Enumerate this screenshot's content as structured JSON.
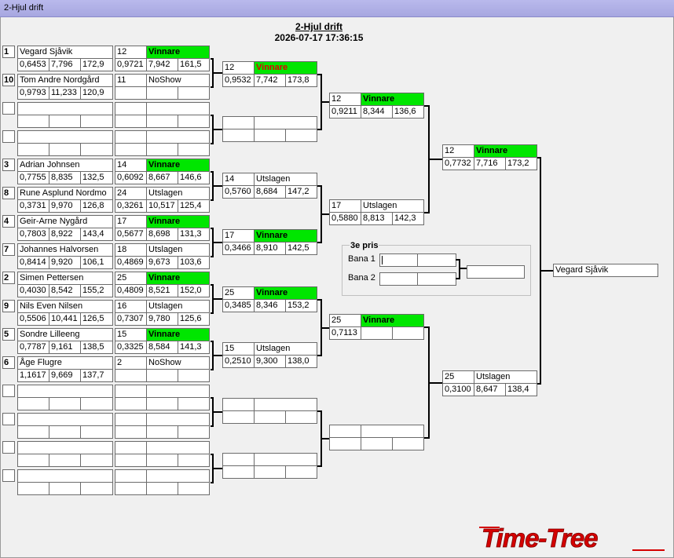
{
  "window": {
    "title": "2-Hjul drift"
  },
  "event": {
    "title": "2-Hjul drift",
    "datetime": "2026-07-17 17:36:15"
  },
  "logo_text": "Time-Tree",
  "colors": {
    "winner_bg": "#00e600",
    "winner_alert_text": "#e00000",
    "titlebar": "#b0b0e6"
  },
  "round1": [
    {
      "seed": "1",
      "name": "Vegard Sjåvik",
      "rt": "0,6453",
      "et": "7,796",
      "speed": "172,9"
    },
    {
      "seed": "10",
      "name": "Tom Andre Nordgård",
      "rt": "0,9793",
      "et": "11,233",
      "speed": "120,9"
    },
    {
      "seed": "",
      "name": "",
      "rt": "",
      "et": "",
      "speed": ""
    },
    {
      "seed": "",
      "name": "",
      "rt": "",
      "et": "",
      "speed": ""
    },
    {
      "seed": "3",
      "name": "Adrian Johnsen",
      "rt": "0,7755",
      "et": "8,835",
      "speed": "132,5"
    },
    {
      "seed": "8",
      "name": "Rune Asplund Nordmo",
      "rt": "0,3731",
      "et": "9,970",
      "speed": "126,8"
    },
    {
      "seed": "4",
      "name": "Geir-Arne Nygård",
      "rt": "0,7803",
      "et": "8,922",
      "speed": "143,4"
    },
    {
      "seed": "7",
      "name": "Johannes Halvorsen",
      "rt": "0,8414",
      "et": "9,920",
      "speed": "106,1"
    },
    {
      "seed": "2",
      "name": "Simen Pettersen",
      "rt": "0,4030",
      "et": "8,542",
      "speed": "155,2"
    },
    {
      "seed": "9",
      "name": "Nils Even Nilsen",
      "rt": "0,5506",
      "et": "10,441",
      "speed": "126,5"
    },
    {
      "seed": "5",
      "name": "Sondre Lilleeng",
      "rt": "0,7787",
      "et": "9,161",
      "speed": "138,5"
    },
    {
      "seed": "6",
      "name": "Åge Flugre",
      "rt": "1,1617",
      "et": "9,669",
      "speed": "137,7"
    },
    {
      "seed": "",
      "name": "",
      "rt": "",
      "et": "",
      "speed": ""
    },
    {
      "seed": "",
      "name": "",
      "rt": "",
      "et": "",
      "speed": ""
    },
    {
      "seed": "",
      "name": "",
      "rt": "",
      "et": "",
      "speed": ""
    },
    {
      "seed": "",
      "name": "",
      "rt": "",
      "et": "",
      "speed": ""
    }
  ],
  "round2": [
    {
      "lane": "12",
      "result": "Vinnare",
      "rt": "0,9721",
      "et": "7,942",
      "speed": "161,5"
    },
    {
      "lane": "11",
      "result": "NoShow",
      "rt": "",
      "et": "",
      "speed": ""
    },
    {
      "lane": "",
      "result": "",
      "rt": "",
      "et": "",
      "speed": ""
    },
    {
      "lane": "",
      "result": "",
      "rt": "",
      "et": "",
      "speed": ""
    },
    {
      "lane": "14",
      "result": "Vinnare",
      "rt": "0,6092",
      "et": "8,667",
      "speed": "146,6"
    },
    {
      "lane": "24",
      "result": "Utslagen",
      "rt": "0,3261",
      "et": "10,517",
      "speed": "125,4"
    },
    {
      "lane": "17",
      "result": "Vinnare",
      "rt": "0,5677",
      "et": "8,698",
      "speed": "131,3"
    },
    {
      "lane": "18",
      "result": "Utslagen",
      "rt": "0,4869",
      "et": "9,673",
      "speed": "103,6"
    },
    {
      "lane": "25",
      "result": "Vinnare",
      "rt": "0,4809",
      "et": "8,521",
      "speed": "152,0"
    },
    {
      "lane": "16",
      "result": "Utslagen",
      "rt": "0,7307",
      "et": "9,780",
      "speed": "125,6"
    },
    {
      "lane": "15",
      "result": "Vinnare",
      "rt": "0,3325",
      "et": "8,584",
      "speed": "141,3"
    },
    {
      "lane": "2",
      "result": "NoShow",
      "rt": "",
      "et": "",
      "speed": ""
    },
    {
      "lane": "",
      "result": "",
      "rt": "",
      "et": "",
      "speed": ""
    },
    {
      "lane": "",
      "result": "",
      "rt": "",
      "et": "",
      "speed": ""
    },
    {
      "lane": "",
      "result": "",
      "rt": "",
      "et": "",
      "speed": ""
    },
    {
      "lane": "",
      "result": "",
      "rt": "",
      "et": "",
      "speed": ""
    }
  ],
  "round3": [
    {
      "lane": "12",
      "result": "Vinnare",
      "rt": "0,9532",
      "et": "7,742",
      "speed": "173,8"
    },
    {
      "lane": "",
      "result": "",
      "rt": "",
      "et": "",
      "speed": ""
    },
    {
      "lane": "14",
      "result": "Utslagen",
      "rt": "0,5760",
      "et": "8,684",
      "speed": "147,2"
    },
    {
      "lane": "17",
      "result": "Vinnare",
      "rt": "0,3466",
      "et": "8,910",
      "speed": "142,5"
    },
    {
      "lane": "25",
      "result": "Vinnare",
      "rt": "0,3485",
      "et": "8,346",
      "speed": "153,2"
    },
    {
      "lane": "15",
      "result": "Utslagen",
      "rt": "0,2510",
      "et": "9,300",
      "speed": "138,0"
    },
    {
      "lane": "",
      "result": "",
      "rt": "",
      "et": "",
      "speed": ""
    },
    {
      "lane": "",
      "result": "",
      "rt": "",
      "et": "",
      "speed": ""
    }
  ],
  "round4": [
    {
      "lane": "12",
      "result": "Vinnare",
      "rt": "0,9211",
      "et": "8,344",
      "speed": "136,6"
    },
    {
      "lane": "17",
      "result": "Utslagen",
      "rt": "0,5880",
      "et": "8,813",
      "speed": "142,3"
    },
    {
      "lane": "25",
      "result": "Vinnare",
      "rt": "0,7113",
      "et": "",
      "speed": ""
    },
    {
      "lane": "",
      "result": "",
      "rt": "",
      "et": "",
      "speed": ""
    }
  ],
  "round5": [
    {
      "lane": "12",
      "result": "Vinnare",
      "rt": "0,7732",
      "et": "7,716",
      "speed": "173,2"
    },
    {
      "lane": "25",
      "result": "Utslagen",
      "rt": "0,3100",
      "et": "8,647",
      "speed": "138,4"
    }
  ],
  "champion": "Vegard Sjåvik",
  "third_prize": {
    "title": "3e pris",
    "lane1_label": "Bana 1",
    "lane2_label": "Bana 2",
    "lane1_value": "",
    "lane2_value": "",
    "result": ""
  }
}
